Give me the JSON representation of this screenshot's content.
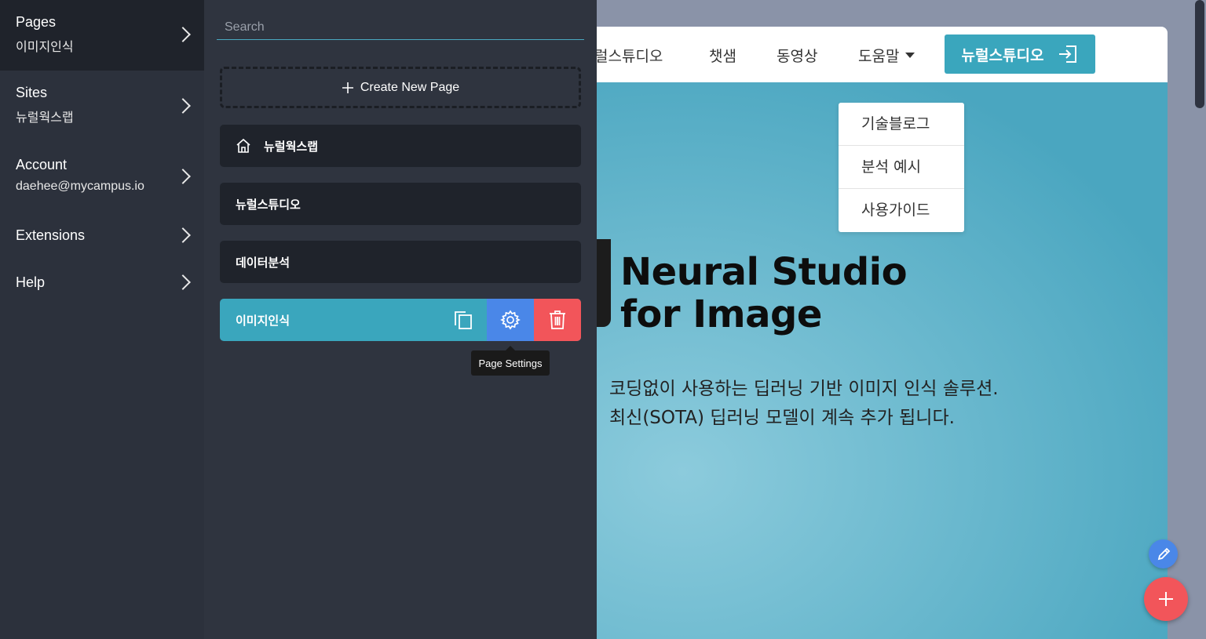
{
  "leftnav": {
    "items": [
      {
        "title": "Pages",
        "sub": "이미지인식"
      },
      {
        "title": "Sites",
        "sub": "뉴럴웍스랩"
      },
      {
        "title": "Account",
        "sub": "daehee@mycampus.io"
      },
      {
        "title": "Extensions",
        "sub": ""
      },
      {
        "title": "Help",
        "sub": ""
      }
    ]
  },
  "panel": {
    "search_placeholder": "Search",
    "create_label": "Create New Page",
    "pages": [
      "뉴럴웍스랩",
      "뉴럴스튜디오",
      "데이터분석",
      "이미지인식"
    ],
    "tooltip": "Page Settings"
  },
  "site": {
    "nav": {
      "link1": "럴스튜디오",
      "link2": "챗샘",
      "link3": "동영상",
      "dropdown": "도움말",
      "cta": "뉴럴스튜디오"
    },
    "dropdown_items": [
      "기술블로그",
      "분석 예시",
      "사용가이드"
    ],
    "hero": {
      "title_line1": "Neural Studio",
      "title_line2": "for Image",
      "desc_line1": "코딩없이 사용하는 딥러닝 기반 이미지 인식 솔루션.",
      "desc_line2": "최신(SOTA) 딥러닝 모델이 계속 추가 됩니다."
    }
  },
  "colors": {
    "accent": "#3aa6bd",
    "settings": "#4a87e8",
    "danger": "#f2555a",
    "panel_bg": "#2f343f",
    "nav_bg": "#2c313c"
  },
  "icons": [
    "chevron-right-icon",
    "plus-icon",
    "home-icon",
    "duplicate-icon",
    "gear-icon",
    "trash-icon",
    "login-icon",
    "pencil-icon",
    "caret-down-icon"
  ]
}
